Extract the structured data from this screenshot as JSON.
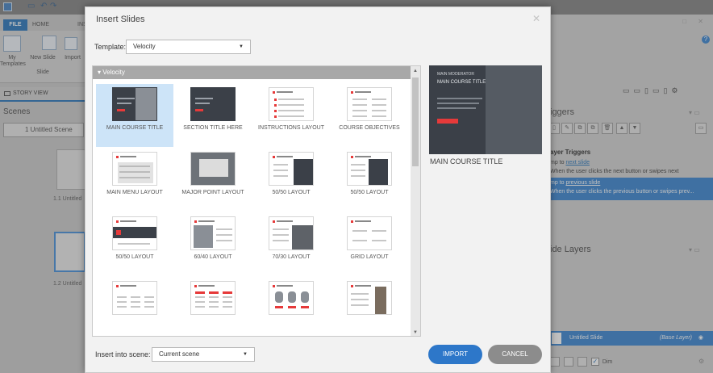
{
  "app": {
    "ribbon_tabs": {
      "file": "FILE",
      "home": "HOME",
      "insert_partial": "INS"
    },
    "ribbon_buttons": {
      "my_templates": "My Templates",
      "new_slide": "New Slide",
      "new_slide_sub": "Slide",
      "import_partial": "Import"
    },
    "story_view_label": "STORY VIEW",
    "scenes_title": "Scenes",
    "scene_select_value": "1 Untitled Scene",
    "slide1_label": "1.1 Untitled",
    "slide2_label": "1.2 Untitled"
  },
  "right_panel": {
    "triggers_title": "iggers",
    "layer_triggers_heading": "ayer Triggers",
    "trigger1_action_prefix": "mp to ",
    "trigger1_link": "next slide",
    "trigger1_condition": "When the user clicks the next button or swipes next",
    "trigger2_action_prefix": "mp to ",
    "trigger2_link": "previous slide",
    "trigger2_condition": "When the user clicks the previous button or swipes prev...",
    "slide_layers_title": "ide Layers",
    "layer_name": "Untitled Slide",
    "layer_base": "(Base Layer)",
    "dim_label": "Dim"
  },
  "dialog": {
    "title": "Insert Slides",
    "template_label": "Template:",
    "template_value": "Velocity",
    "group_header": "Velocity",
    "tiles": [
      {
        "label": "MAIN COURSE TITLE",
        "style": "dark-photo",
        "selected": true
      },
      {
        "label": "SECTION TITLE HERE",
        "style": "dark"
      },
      {
        "label": "INSTRUCTIONS LAYOUT",
        "style": "text"
      },
      {
        "label": "COURSE OBJECTIVES",
        "style": "text-cols"
      },
      {
        "label": "MAIN MENU LAYOUT",
        "style": "menu"
      },
      {
        "label": "MAJOR POINT LAYOUT",
        "style": "photo"
      },
      {
        "label": "50/50 LAYOUT",
        "style": "split-dark"
      },
      {
        "label": "50/50 LAYOUT",
        "style": "split-dark-right"
      },
      {
        "label": "50/50 LAYOUT",
        "style": "banner"
      },
      {
        "label": "60/40 LAYOUT",
        "style": "photo-left"
      },
      {
        "label": "70/30 LAYOUT",
        "style": "photo-right"
      },
      {
        "label": "GRID LAYOUT",
        "style": "grid"
      },
      {
        "label": "",
        "style": "cols3"
      },
      {
        "label": "",
        "style": "cols3-red"
      },
      {
        "label": "",
        "style": "people"
      },
      {
        "label": "",
        "style": "person"
      }
    ],
    "preview": {
      "small_text": "MAIN MODERATOR",
      "title_text": "MAIN COURSE TITLE",
      "caption": "MAIN COURSE TITLE"
    },
    "insert_label": "Insert into scene:",
    "scene_value": "Current scene",
    "import_button": "IMPORT",
    "cancel_button": "CANCEL"
  },
  "colors": {
    "accent_blue": "#2d77c9",
    "slide_dark": "#3b4048",
    "slide_red": "#e63a3a",
    "cancel_gray": "#8c8c8c"
  }
}
